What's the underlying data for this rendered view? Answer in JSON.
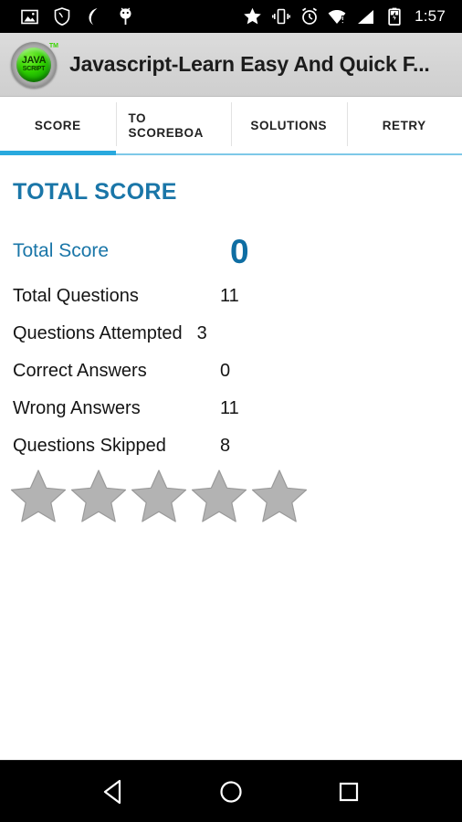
{
  "status_bar": {
    "left_icons": [
      "image-icon",
      "shield-icon",
      "moon-icon",
      "android-robot-icon"
    ],
    "right_icons": [
      "star-icon",
      "vibrate-icon",
      "alarm-clock-icon",
      "wifi-alert-icon",
      "signal-bars-icon",
      "battery-charging-icon"
    ],
    "time": "1:57"
  },
  "app_bar": {
    "logo_line1": "JAVA",
    "logo_line2": "SCRIPT",
    "logo_tm": "TM",
    "title": "Javascript-Learn Easy And Quick F..."
  },
  "tabs": [
    {
      "label": "SCORE",
      "active": true
    },
    {
      "label": "TO\nSCOREBOA",
      "active": false
    },
    {
      "label": "SOLUTIONS",
      "active": false
    },
    {
      "label": "RETRY",
      "active": false
    }
  ],
  "main": {
    "section_title": "TOTAL SCORE",
    "total_score_label": "Total Score",
    "total_score_value": "0",
    "stats": [
      {
        "label": "Total Questions",
        "value": "11"
      },
      {
        "label": "Questions Attempted",
        "value": "3"
      },
      {
        "label": "Correct Answers",
        "value": "0"
      },
      {
        "label": "Wrong Answers",
        "value": "11"
      },
      {
        "label": "Questions Skipped",
        "value": "8"
      }
    ],
    "rating": {
      "total": 5,
      "filled": 0
    }
  },
  "nav_bar": {
    "back": "back-triangle-icon",
    "home": "home-circle-icon",
    "recents": "recents-square-icon"
  },
  "colors": {
    "accent_blue": "#29a9de",
    "heading_blue": "#1a76a8",
    "score_blue": "#0f6ea3",
    "app_bar_gray": "#d4d4d4",
    "star_gray": "#b3b3b3",
    "text_dark": "#141414"
  }
}
